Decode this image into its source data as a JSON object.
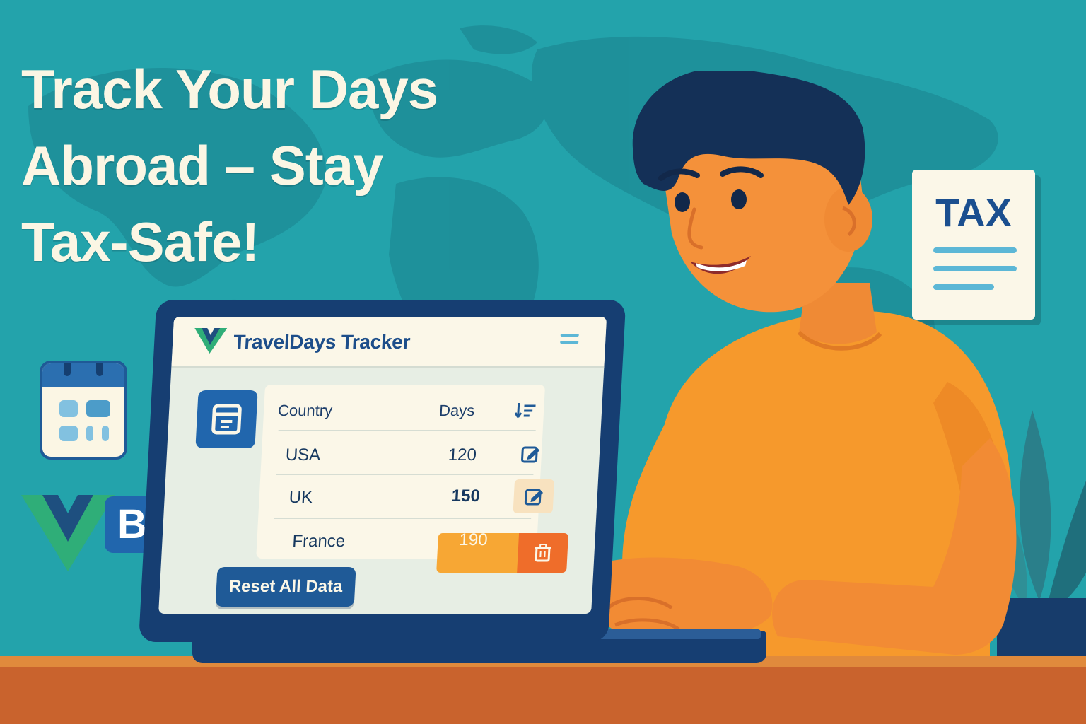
{
  "headline": {
    "line1": "Track Your Days",
    "line2": "Abroad – Stay",
    "line3": "Tax-Safe!"
  },
  "tax_document": {
    "title": "TAX"
  },
  "bootstrap_logo": {
    "letter": "B"
  },
  "app": {
    "title": "TravelDays Tracker",
    "table": {
      "columns": [
        "Country",
        "Days"
      ],
      "rows": [
        {
          "country": "USA",
          "days": "120",
          "action": "edit"
        },
        {
          "country": "UK",
          "days": "150",
          "action": "edit"
        },
        {
          "country": "France",
          "days": "190",
          "action": "delete"
        }
      ]
    },
    "reset_label": "Reset All Data"
  },
  "icons": {
    "menu": "hamburger-menu-icon",
    "table": "table-icon",
    "sort": "list-sort-icon",
    "edit": "edit-icon",
    "delete": "trash-icon",
    "calendar": "calendar-icon"
  },
  "colors": {
    "background": "#23a3ab",
    "primary": "#2166ad",
    "accent_orange": "#f7a734",
    "danger_orange": "#ef6d2a",
    "cream": "#fbf7e8"
  }
}
